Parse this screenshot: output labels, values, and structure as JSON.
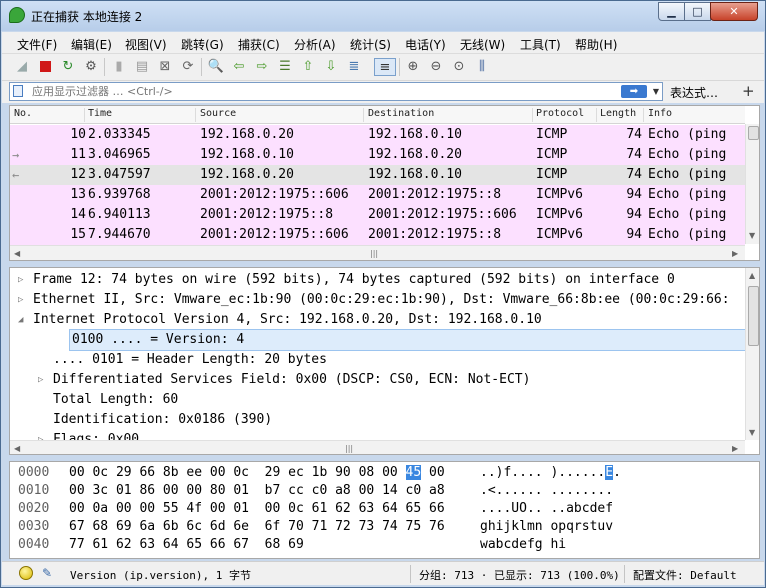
{
  "window": {
    "title": "正在捕获 本地连接 2",
    "min_glyph": "▁",
    "max_glyph": "□",
    "close_glyph": "✕"
  },
  "menu": [
    "文件(F)",
    "编辑(E)",
    "视图(V)",
    "跳转(G)",
    "捕获(C)",
    "分析(A)",
    "统计(S)",
    "电话(Y)",
    "无线(W)",
    "工具(T)",
    "帮助(H)"
  ],
  "filter": {
    "placeholder": "应用显示过滤器 … <Ctrl-/>",
    "apply_glyph": "➡",
    "dropdown_glyph": "▼",
    "expression_label": "表达式…",
    "add_glyph": "+"
  },
  "packet_list": {
    "columns": [
      "No.",
      "Time",
      "Source",
      "Destination",
      "Protocol",
      "Length",
      "Info"
    ],
    "rows": [
      {
        "no": "10",
        "time": "2.033345",
        "source": "192.168.0.20",
        "destination": "192.168.0.10",
        "protocol": "ICMP",
        "length": "74",
        "info": "Echo (ping",
        "mark": ""
      },
      {
        "no": "11",
        "time": "3.046965",
        "source": "192.168.0.10",
        "destination": "192.168.0.20",
        "protocol": "ICMP",
        "length": "74",
        "info": "Echo (ping",
        "mark": "→"
      },
      {
        "no": "12",
        "time": "3.047597",
        "source": "192.168.0.20",
        "destination": "192.168.0.10",
        "protocol": "ICMP",
        "length": "74",
        "info": "Echo (ping",
        "mark": "←"
      },
      {
        "no": "13",
        "time": "6.939768",
        "source": "2001:2012:1975::606",
        "destination": "2001:2012:1975::8",
        "protocol": "ICMPv6",
        "length": "94",
        "info": "Echo (ping",
        "mark": ""
      },
      {
        "no": "14",
        "time": "6.940113",
        "source": "2001:2012:1975::8",
        "destination": "2001:2012:1975::606",
        "protocol": "ICMPv6",
        "length": "94",
        "info": "Echo (ping",
        "mark": ""
      },
      {
        "no": "15",
        "time": "7.944670",
        "source": "2001:2012:1975::606",
        "destination": "2001:2012:1975::8",
        "protocol": "ICMPv6",
        "length": "94",
        "info": "Echo (ping",
        "mark": ""
      }
    ],
    "selected_row": 2,
    "row_color": "#fce0ff",
    "selected_color": "#e4e4e4"
  },
  "details": {
    "rows": [
      {
        "text": "Frame 12: 74 bytes on wire (592 bits), 74 bytes captured (592 bits) on interface 0",
        "level": 0,
        "expander": "▷"
      },
      {
        "text": "Ethernet II, Src: Vmware_ec:1b:90 (00:0c:29:ec:1b:90), Dst: Vmware_66:8b:ee (00:0c:29:66:",
        "level": 0,
        "expander": "▷"
      },
      {
        "text": "Internet Protocol Version 4, Src: 192.168.0.20, Dst: 192.168.0.10",
        "level": 0,
        "expander": "◢"
      },
      {
        "text": "0100 .... = Version: 4",
        "level": 1,
        "expander": ""
      },
      {
        "text": ".... 0101 = Header Length: 20 bytes",
        "level": 1,
        "expander": ""
      },
      {
        "text": "Differentiated Services Field: 0x00 (DSCP: CS0, ECN: Not-ECT)",
        "level": 1,
        "expander": "▷"
      },
      {
        "text": "Total Length: 60",
        "level": 1,
        "expander": ""
      },
      {
        "text": "Identification: 0x0186 (390)",
        "level": 1,
        "expander": ""
      },
      {
        "text": "Flags: 0x00",
        "level": 1,
        "expander": "▷"
      }
    ],
    "selected_row": 3
  },
  "bytes": {
    "rows": [
      {
        "offset": "0000",
        "hex_a": "00 0c 29 66 8b ee 00 0c  29 ec 1b 90 08 00 ",
        "hex_hl": "45",
        "hex_b": " 00",
        "ascii_a": "..)f.... )......",
        "ascii_hl": "E",
        "ascii_b": "."
      },
      {
        "offset": "0010",
        "hex_a": "00 3c 01 86 00 00 80 01  b7 cc c0 a8 00 14 c0 a8",
        "hex_hl": "",
        "hex_b": "",
        "ascii_a": ".<...... ........",
        "ascii_hl": "",
        "ascii_b": ""
      },
      {
        "offset": "0020",
        "hex_a": "00 0a 00 00 55 4f 00 01  00 0c 61 62 63 64 65 66",
        "hex_hl": "",
        "hex_b": "",
        "ascii_a": "....UO.. ..abcdef",
        "ascii_hl": "",
        "ascii_b": ""
      },
      {
        "offset": "0030",
        "hex_a": "67 68 69 6a 6b 6c 6d 6e  6f 70 71 72 73 74 75 76",
        "hex_hl": "",
        "hex_b": "",
        "ascii_a": "ghijklmn opqrstuv",
        "ascii_hl": "",
        "ascii_b": ""
      },
      {
        "offset": "0040",
        "hex_a": "77 61 62 63 64 65 66 67  68 69",
        "hex_hl": "",
        "hex_b": "",
        "ascii_a": "wabcdefg hi",
        "ascii_hl": "",
        "ascii_b": ""
      }
    ]
  },
  "status": {
    "field_info": "Version (ip.version), 1 字节",
    "packets": "分组: 713 · 已显示: 713 (100.0%)",
    "profile": "配置文件: Default"
  },
  "colors": {
    "accent": "#3a87e0",
    "titlebar": "#c3d6ee",
    "details_selected": "#ddecfb"
  }
}
